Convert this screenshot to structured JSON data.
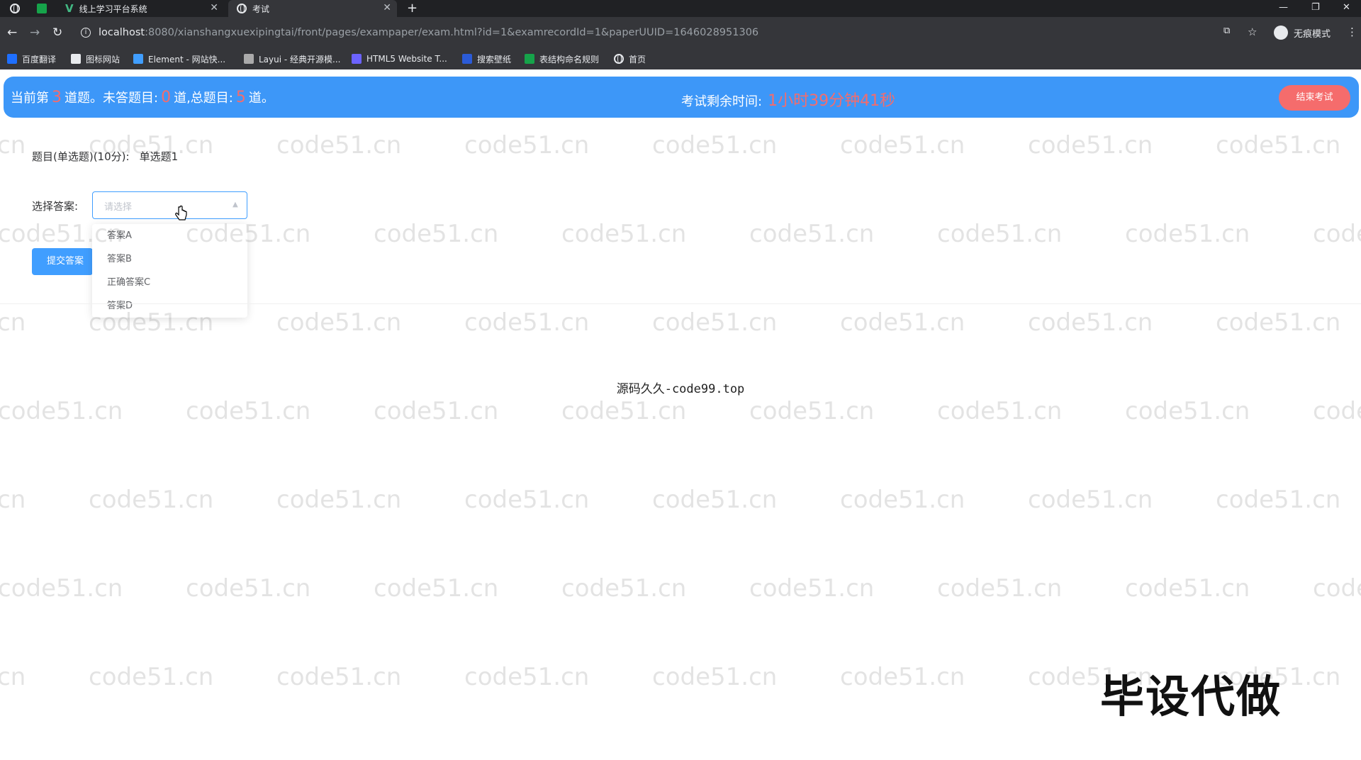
{
  "browser": {
    "tabs": [
      {
        "title": "线上学习平台系统"
      },
      {
        "title": "考试"
      }
    ],
    "url_host": "localhost",
    "url_rest": ":8080/xianshangxuexipingtai/front/pages/exampaper/exam.html?id=1&examrecordId=1&paperUUID=1646028951306",
    "incognito_label": "无痕模式",
    "bookmarks": [
      {
        "label": "百度翻译",
        "color": "#1e6fff"
      },
      {
        "label": "图标网站",
        "color": "#e8eaed"
      },
      {
        "label": "Element - 网站快...",
        "color": "#409eff"
      },
      {
        "label": "Layui - 经典开源模...",
        "color": "#aaaaaa"
      },
      {
        "label": "HTML5 Website T...",
        "color": "#6c63ff"
      },
      {
        "label": "搜索壁纸",
        "color": "#2b5bd7"
      },
      {
        "label": "表结构命名规则",
        "color": "#16a34a"
      },
      {
        "label": "首页",
        "color": "#e8eaed"
      }
    ]
  },
  "header": {
    "current_prefix": "当前第",
    "current_num": "3",
    "current_suffix": "道题。未答题目:",
    "unanswered_num": "0",
    "unanswered_suffix": "道,总题目:",
    "total_num": "5",
    "total_suffix": "道。",
    "time_label": "考试剩余时间:",
    "time_value": "1小时39分钟41秒",
    "end_button": "结束考试",
    "accent_color": "#3d97f8",
    "highlight_color": "#f56c6c"
  },
  "question": {
    "title": "题目(单选题)(10分):",
    "text": "单选题1"
  },
  "answer": {
    "label": "选择答案:",
    "placeholder": "请选择",
    "options": [
      "答案A",
      "答案B",
      "正确答案C",
      "答案D"
    ]
  },
  "submit_button": "提交答案",
  "source_text": "源码久久-code99.top",
  "stamp_text": "毕设代做",
  "watermark_text": "code51.cn"
}
